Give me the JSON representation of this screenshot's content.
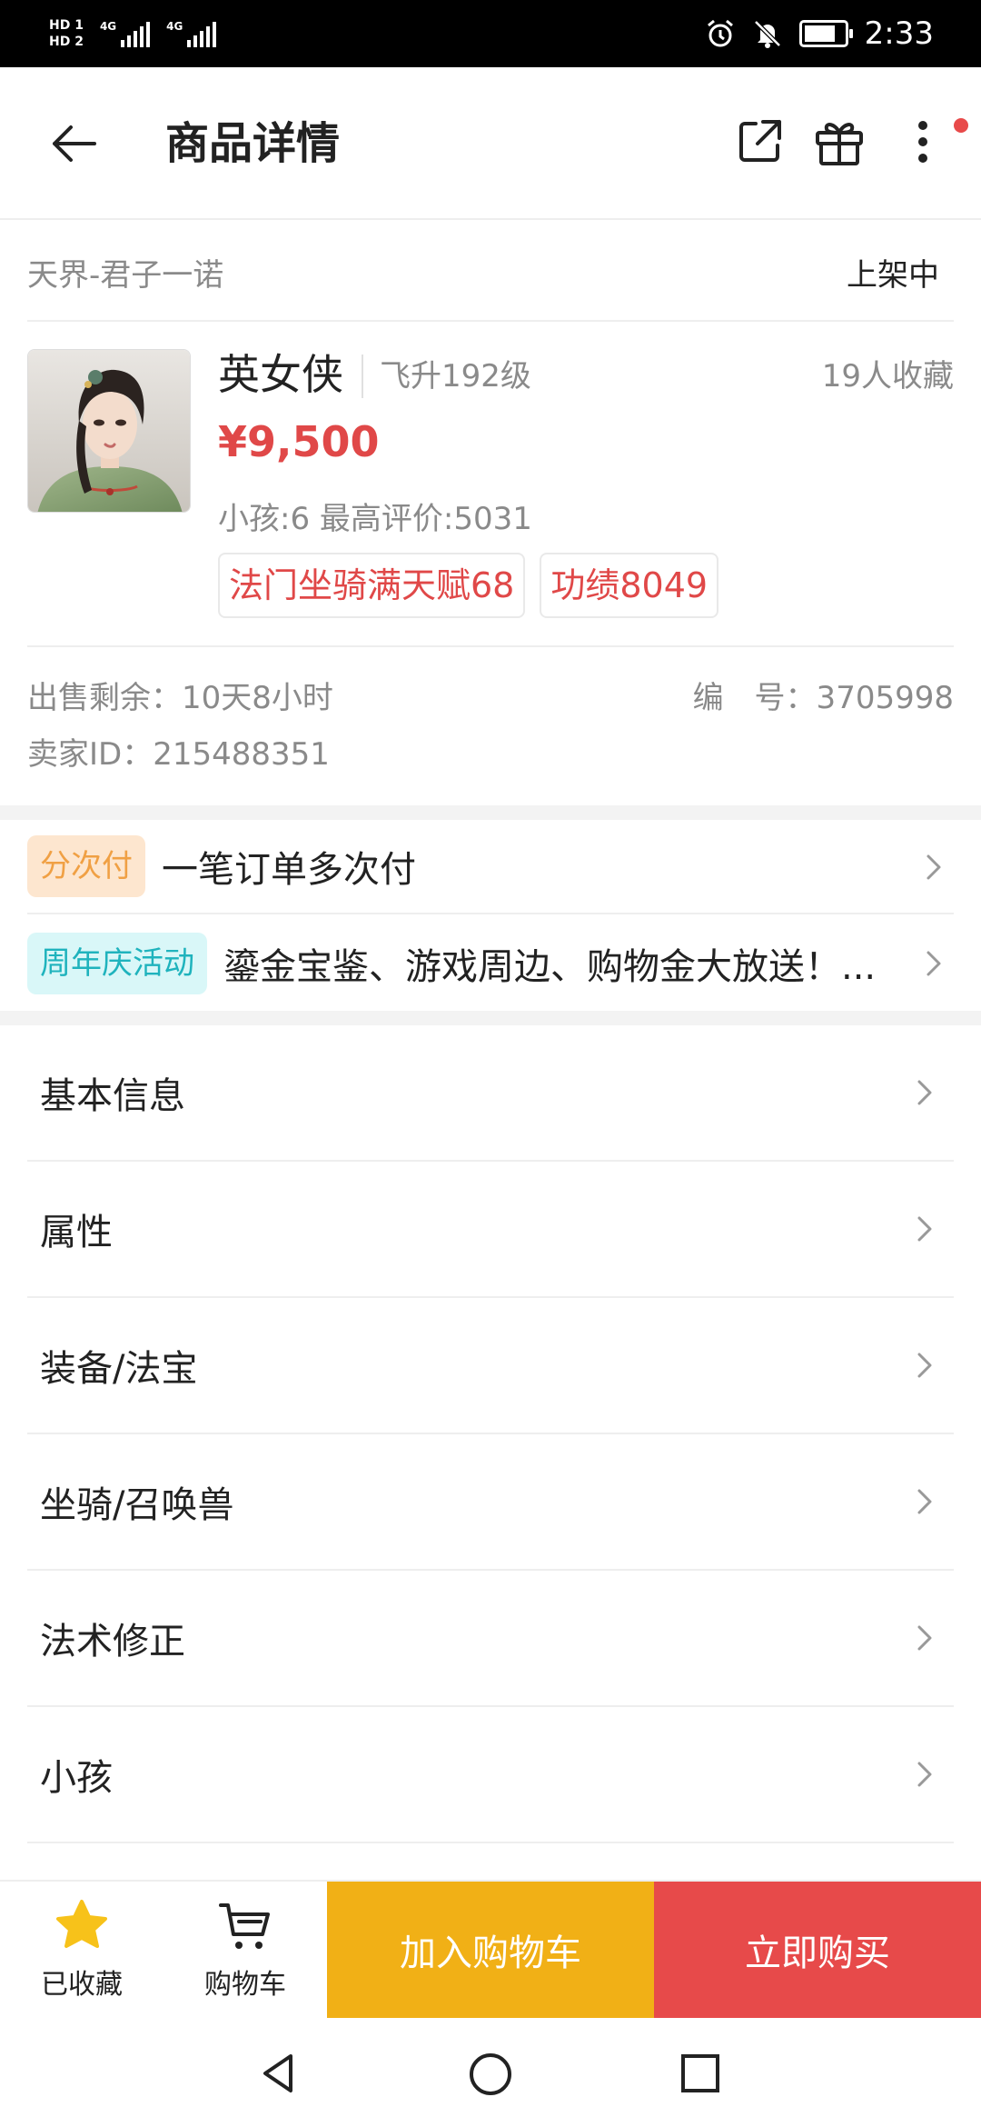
{
  "status_bar": {
    "sim1": "HD 1",
    "sim2": "HD 2",
    "net1": "4G",
    "net2": "4G",
    "time": "2:33",
    "icons": [
      "alarm-icon",
      "mute-icon",
      "battery-charging-icon"
    ],
    "battery_level": 0.8
  },
  "header": {
    "title": "商品详情",
    "icons": [
      "back-arrow-icon",
      "share-icon",
      "gift-icon",
      "more-vertical-icon"
    ]
  },
  "server_row": {
    "server": "天界-君子一诺",
    "status": "上架中"
  },
  "product": {
    "name": "英女侠",
    "level": "飞升192级",
    "favorites": "19人收藏",
    "price": "¥9,500",
    "stats": "小孩:6 最高评价:5031",
    "tags": [
      "法门坐骑满天赋68",
      "功绩8049"
    ]
  },
  "meta": {
    "remaining": "出售剩余：10天8小时",
    "serial": "编　号：3705998",
    "seller": "卖家ID：215488351"
  },
  "promos": [
    {
      "badge": "分次付",
      "text": "一笔订单多次付"
    },
    {
      "badge": "周年庆活动",
      "text": "鎏金宝鉴、游戏周边、购物金大放送！..."
    }
  ],
  "sections": [
    {
      "label": "基本信息"
    },
    {
      "label": "属性"
    },
    {
      "label": "装备/法宝"
    },
    {
      "label": "坐骑/召唤兽"
    },
    {
      "label": "法术修正"
    },
    {
      "label": "小孩"
    }
  ],
  "bottom_bar": {
    "favorited_label": "已收藏",
    "cart_label": "购物车",
    "add_to_cart": "加入购物车",
    "buy_now": "立即购买"
  },
  "colors": {
    "price_red": "#e04848",
    "cart_button": "#f1b016",
    "buy_button": "#e74a4a",
    "star_yellow": "#f7c21a"
  }
}
